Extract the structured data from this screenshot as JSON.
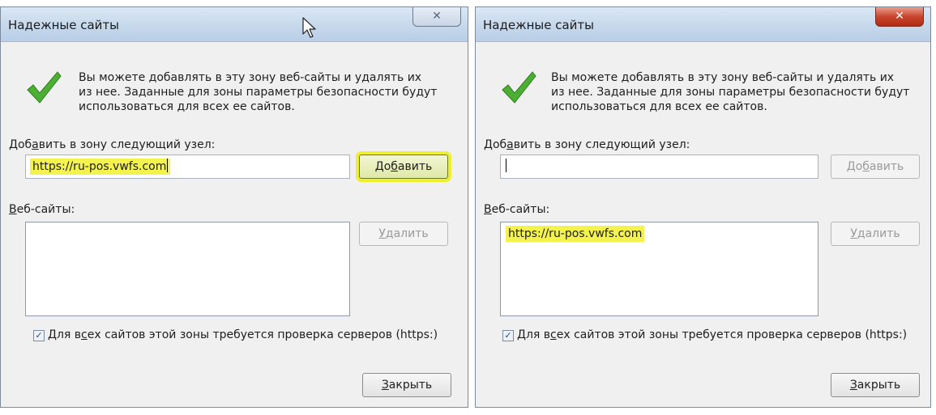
{
  "left_dialog": {
    "title": "Надежные сайты",
    "close_glyph": "✕",
    "info": {
      "line1": "Вы можете добавлять в эту зону  веб-сайты и удалять их",
      "line2": "из нее. Заданные для зоны параметры безопасности будут",
      "line3": "использоваться для всех ее сайтов."
    },
    "add_label_pre": "Доб",
    "add_label_accel": "а",
    "add_label_post": "вить в зону следующий узел:",
    "add_field_value": "https://ru-pos.vwfs.com",
    "add_button_pre": "До",
    "add_button_accel": "б",
    "add_button_post": "авить",
    "websites_label_accel": "В",
    "websites_label_post": "еб-сайты:",
    "websites": [],
    "remove_button_accel": "У",
    "remove_button_post": "далить",
    "checkbox_checked": true,
    "checkbox_label_pre": "Для в",
    "checkbox_label_accel": "с",
    "checkbox_label_post": "ех сайтов этой зоны требуется проверка серверов (https:)",
    "close_button_accel": "З",
    "close_button_post": "акрыть"
  },
  "right_dialog": {
    "title": "Надежные сайты",
    "close_glyph": "✕",
    "info": {
      "line1": "Вы можете добавлять в эту зону  веб-сайты и удалять их",
      "line2": "из нее. Заданные для зоны параметры безопасности будут",
      "line3": "использоваться для всех ее сайтов."
    },
    "add_label_pre": "Доб",
    "add_label_accel": "а",
    "add_label_post": "вить в зону следующий узел:",
    "add_field_value": "",
    "add_button_pre": "До",
    "add_button_accel": "б",
    "add_button_post": "авить",
    "websites_label_accel": "В",
    "websites_label_post": "еб-сайты:",
    "websites": [
      "https://ru-pos.vwfs.com"
    ],
    "remove_button_accel": "У",
    "remove_button_post": "далить",
    "checkbox_checked": true,
    "checkbox_label_pre": "Для в",
    "checkbox_label_accel": "с",
    "checkbox_label_post": "ех сайтов этой зоны требуется проверка серверов (https:)",
    "close_button_accel": "З",
    "close_button_post": "акрыть"
  },
  "colors": {
    "highlight": "#f4f24d",
    "checkmark": "#4caf33",
    "close_active": "#c9452d"
  }
}
